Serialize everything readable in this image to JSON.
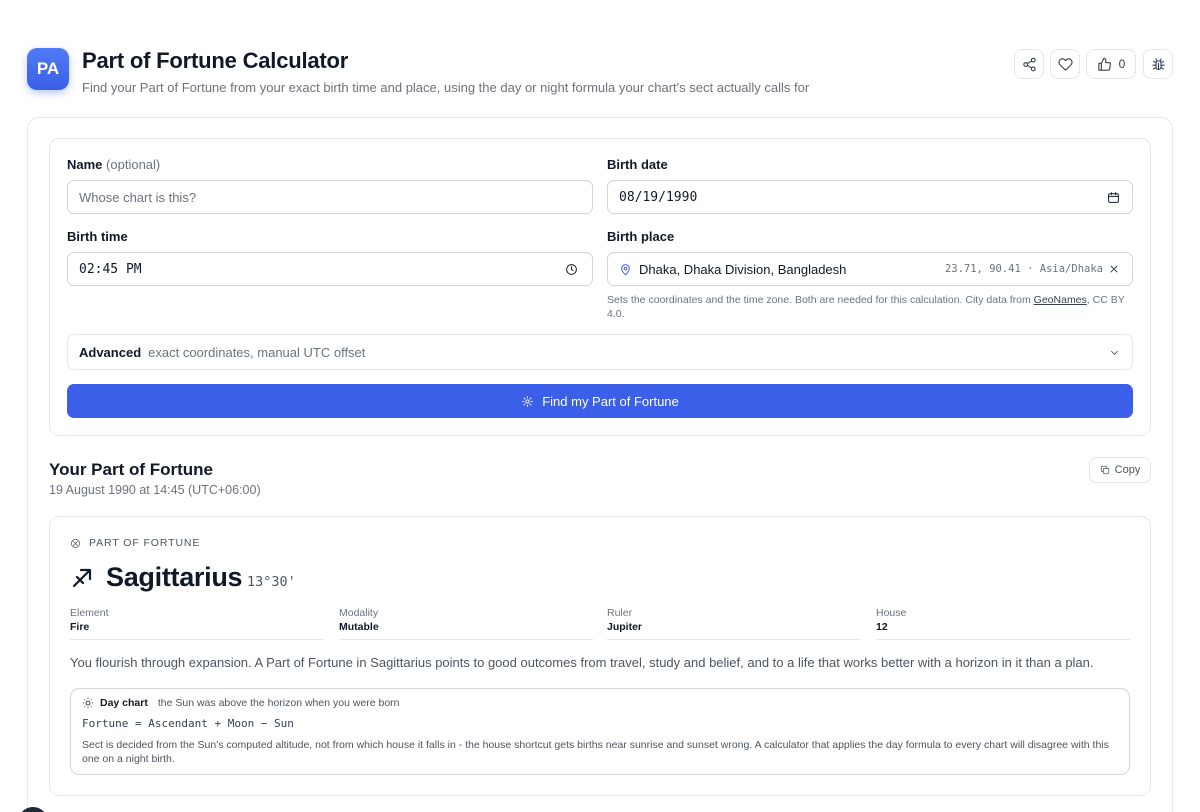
{
  "app": {
    "logo_initials": "PA",
    "title": "Part of Fortune Calculator",
    "subtitle": "Find your Part of Fortune from your exact birth time and place, using the day or night formula your chart's sect actually calls for",
    "like_count": "0",
    "icons": [
      "share-icon",
      "heart-icon",
      "thumbs-up-icon",
      "bug-icon"
    ]
  },
  "form": {
    "name_label": "Name",
    "name_optional": "(optional)",
    "name_placeholder": "Whose chart is this?",
    "birth_date_label": "Birth date",
    "birth_date_value": "08/19/1990",
    "birth_time_label": "Birth time",
    "birth_time_value": "02:45 PM",
    "birth_place_label": "Birth place",
    "birth_place_value": "Dhaka, Dhaka Division, Bangladesh",
    "birth_place_meta": "23.71, 90.41 · Asia/Dhaka",
    "help_prefix": "Sets the coordinates and the time zone. Both are needed for this calculation. City data from ",
    "help_link": "GeoNames",
    "help_suffix": ", CC BY 4.0.",
    "advanced_label": "Advanced",
    "advanced_hint": "exact coordinates, manual UTC offset",
    "submit_label": "Find my Part of Fortune"
  },
  "result": {
    "title": "Your Part of Fortune",
    "datetime": "19 August 1990 at 14:45 (UTC+06:00)",
    "copy_label": "Copy",
    "eyebrow": "PART OF FORTUNE",
    "sign_glyph": "sagittarius-icon",
    "sign": "Sagittarius",
    "degree": "13°30'",
    "attributes": [
      {
        "key": "Element",
        "value": "Fire"
      },
      {
        "key": "Modality",
        "value": "Mutable"
      },
      {
        "key": "Ruler",
        "value": "Jupiter"
      },
      {
        "key": "House",
        "value": "12"
      }
    ],
    "description": "You flourish through expansion. A Part of Fortune in Sagittarius points to good outcomes from travel, study and belief, and to a life that works better with a horizon in it than a plan.",
    "sect_label": "Day chart",
    "sect_detail": "the Sun was above the horizon when you were born",
    "formula": "Fortune = Ascendant + Moon − Sun",
    "sect_note": "Sect is decided from the Sun's computed altitude, not from which house it falls in - the house shortcut gets births near sunrise and sunset wrong. A calculator that applies the day formula to every chart will disagree with this one on a night birth."
  },
  "colors": {
    "accent": "#3b5fe8",
    "text": "#111827",
    "muted": "#6b7280",
    "border": "#e5e7eb"
  }
}
